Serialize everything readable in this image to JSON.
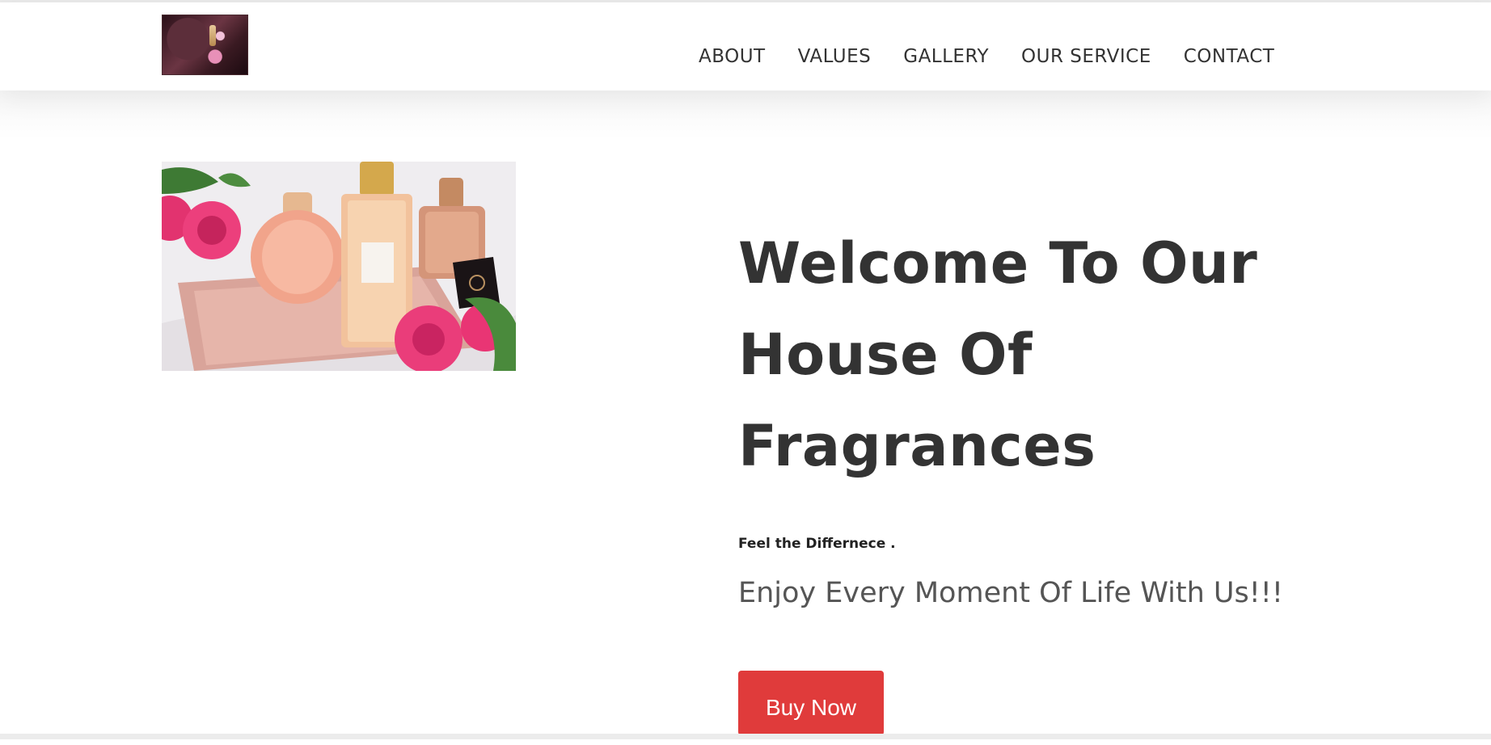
{
  "header": {
    "logo": "perfume-logo",
    "nav": [
      {
        "label": "ABOUT"
      },
      {
        "label": "VALUES"
      },
      {
        "label": "GALLERY"
      },
      {
        "label": "OUR SERVICE"
      },
      {
        "label": "CONTACT"
      }
    ]
  },
  "hero": {
    "image": "perfume-bottles-with-roses-image",
    "headline_lines": [
      "Welcome To Our",
      "House Of",
      "Fragrances"
    ],
    "tagline": "Feel the Differnece .",
    "subline": "Enjoy Every Moment Of Life With Us!!!",
    "button_label": "Buy Now"
  },
  "colors": {
    "accent": "#e03b3b",
    "text": "#333333",
    "subtext": "#555555"
  }
}
